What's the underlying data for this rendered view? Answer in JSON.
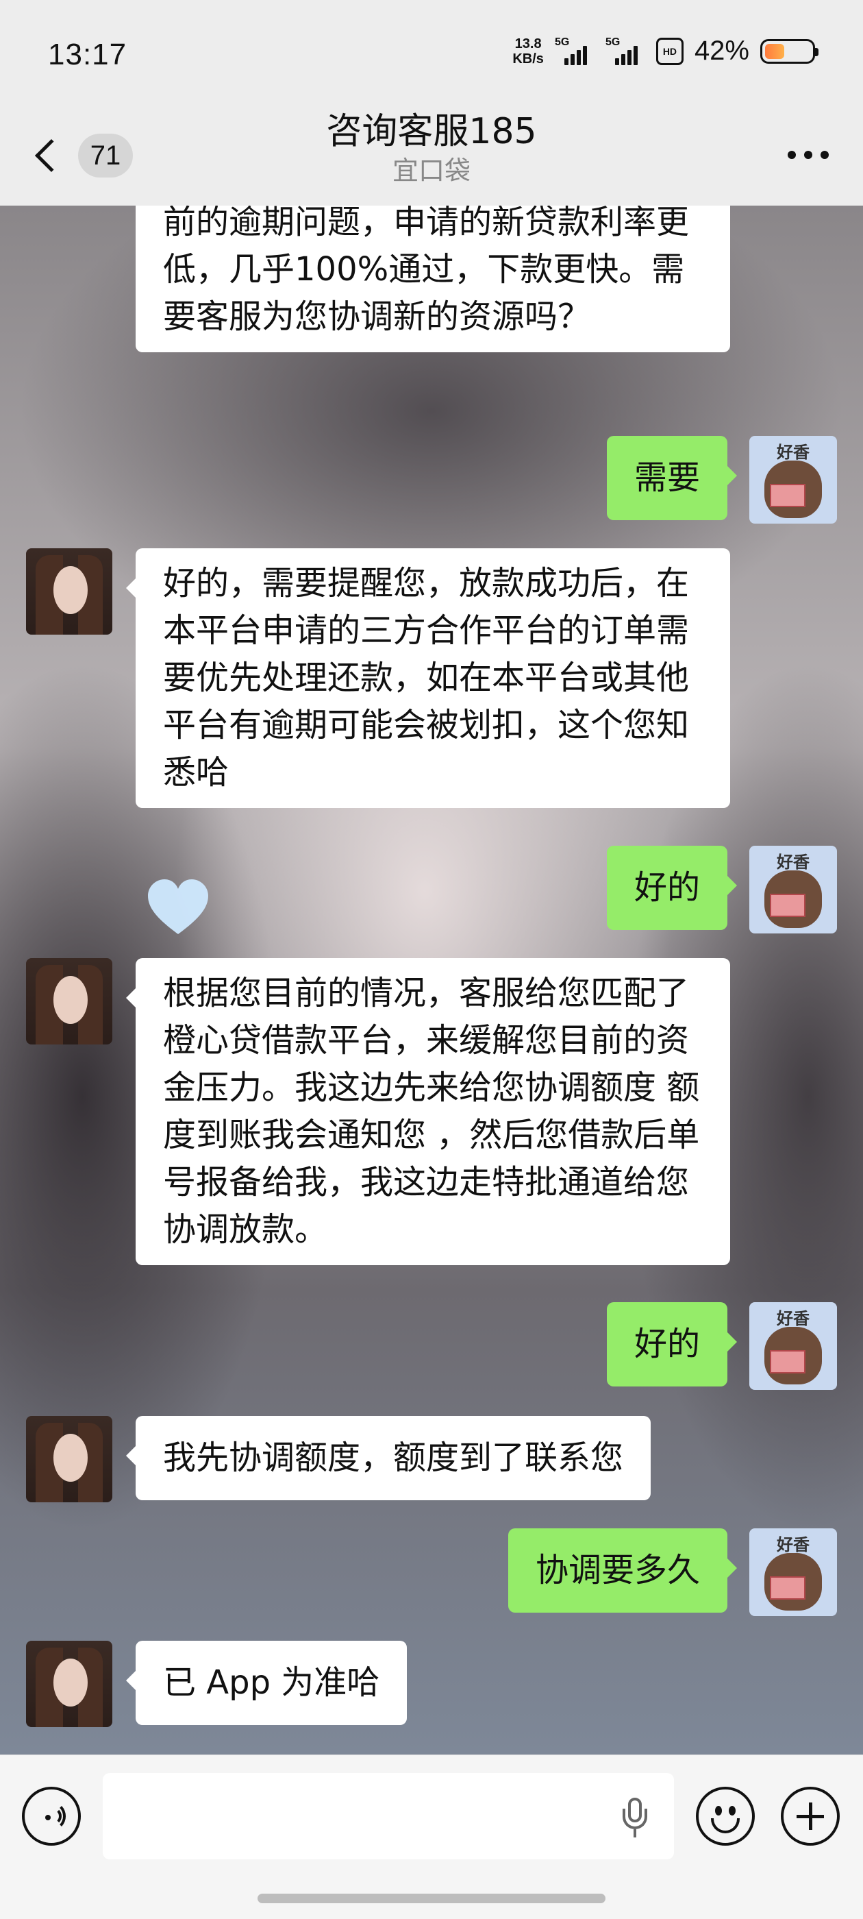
{
  "status_bar": {
    "time": "13:17",
    "net_speed_value": "13.8",
    "net_speed_unit": "KB/s",
    "sim1_label": "5G",
    "sim2_label": "5G",
    "hd_label": "HD",
    "battery_percent": "42%",
    "battery_level": 0.42
  },
  "header": {
    "unread_badge": "71",
    "title": "咨询客服185",
    "subtitle": "宜口袋"
  },
  "messages": [
    {
      "side": "left",
      "text": "前的逾期问题，申请的新贷款利率更低，几乎100%通过，下款更快。需要客服为您协调新的资源吗？"
    },
    {
      "side": "right",
      "text": "需要"
    },
    {
      "side": "left",
      "text": "好的，需要提醒您，放款成功后，在本平台申请的三方合作平台的订单需要优先处理还款，如在本平台或其他平台有逾期可能会被划扣，这个您知悉哈"
    },
    {
      "side": "right",
      "text": "好的"
    },
    {
      "side": "left",
      "text": "根据您目前的情况，客服给您匹配了橙心贷借款平台，来缓解您目前的资金压力。我这边先来给您协调额度 额度到账我会通知您 ，然后您借款后单号报备给我，我这边走特批通道给您协调放款。"
    },
    {
      "side": "right",
      "text": "好的"
    },
    {
      "side": "left",
      "text": "我先协调额度，额度到了联系您"
    },
    {
      "side": "right",
      "text": "协调要多久"
    },
    {
      "side": "left",
      "text": "已 App 为准哈"
    }
  ],
  "sticker_avatar_label": "好香",
  "input": {
    "value": "",
    "placeholder": ""
  },
  "colors": {
    "sent_bubble": "#95ec69",
    "received_bubble": "#ffffff",
    "background": "#ededed"
  }
}
